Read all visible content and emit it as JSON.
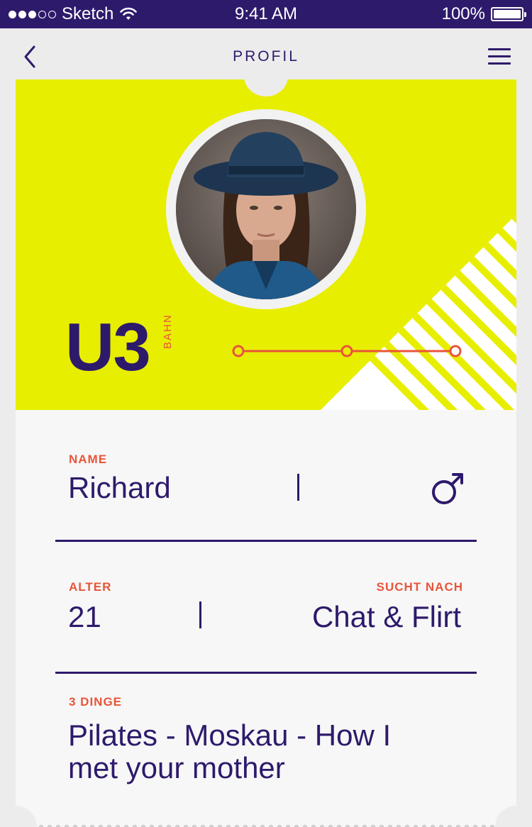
{
  "status_bar": {
    "carrier": "Sketch",
    "time": "9:41 AM",
    "battery": "100%",
    "signal_bars_filled": 3,
    "signal_bars_total": 5
  },
  "nav": {
    "title": "PROFIL",
    "back_icon": "chevron-left-icon",
    "menu_icon": "hamburger-menu-icon"
  },
  "ticket": {
    "line_code": "U3",
    "line_type": "BAHN",
    "route_stops": 3,
    "avatar_alt": "profile photo"
  },
  "profile": {
    "name_label": "NAME",
    "name_value": "Richard",
    "gender_icon": "male-symbol-icon",
    "age_label": "ALTER",
    "age_value": "21",
    "seeking_label": "SUCHT NACH",
    "seeking_value": "Chat & Flirt",
    "things_label": "3 DINGE",
    "things_value": "Pilates - Moskau - How I met your mother"
  },
  "colors": {
    "primary": "#2e1a6b",
    "accent": "#e8553a",
    "ticket_yellow": "#e8ee00",
    "background": "#ececec"
  }
}
